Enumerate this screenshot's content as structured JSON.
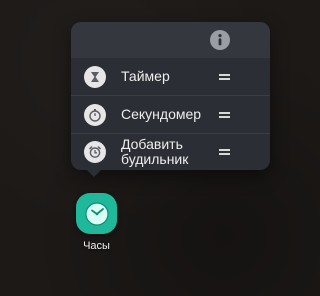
{
  "popup": {
    "info_button_icon": "info-icon",
    "items": [
      {
        "label": "Таймер",
        "icon": "hourglass-icon"
      },
      {
        "label": "Секундомер",
        "icon": "stopwatch-icon"
      },
      {
        "label": "Добавить\nбудильник",
        "icon": "alarm-clock-icon"
      }
    ]
  },
  "app": {
    "label": "Часы",
    "icon": "clock-icon",
    "icon_color": "#1fb89a"
  }
}
